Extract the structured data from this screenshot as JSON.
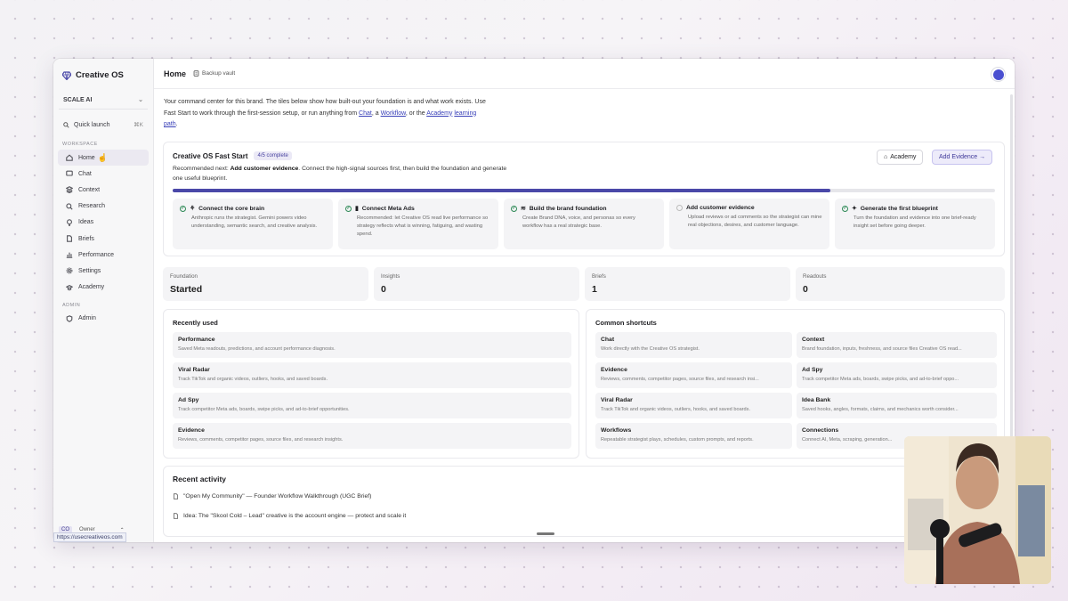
{
  "app": {
    "name": "Creative OS",
    "org": "SCALE AI",
    "quick_launch": "Quick launch",
    "quick_launch_kbd": "⌘K"
  },
  "sidebar": {
    "workspace_label": "WORKSPACE",
    "admin_label": "ADMIN",
    "items": [
      {
        "label": "Home",
        "icon": "home-icon"
      },
      {
        "label": "Chat",
        "icon": "chat-icon"
      },
      {
        "label": "Context",
        "icon": "context-icon"
      },
      {
        "label": "Research",
        "icon": "search-icon"
      },
      {
        "label": "Ideas",
        "icon": "lightbulb-icon"
      },
      {
        "label": "Briefs",
        "icon": "document-icon"
      },
      {
        "label": "Performance",
        "icon": "chart-icon"
      },
      {
        "label": "Settings",
        "icon": "gear-icon"
      },
      {
        "label": "Academy",
        "icon": "graduation-cap-icon"
      }
    ],
    "admin_item": "Admin",
    "footer_co": "CO",
    "footer_role": "Owner"
  },
  "status_url": "https://usecreativeos.com",
  "header": {
    "title": "Home",
    "vault": "Backup vault"
  },
  "intro": {
    "line1": "Your command center for this brand. The tiles below show how built-out your foundation is and what work exists.",
    "line2a": "Use Fast Start to work through the first-session setup, or run anything from ",
    "chat": "Chat",
    "sep1": ", a ",
    "workflow": "Workflow",
    "sep2": ", or the ",
    "academy": "Academy",
    "line2b": "learning path",
    "end": "."
  },
  "fast_start": {
    "title": "Creative OS Fast Start",
    "badge": "4/5 complete",
    "progress": 0.8,
    "rec_prefix": "Recommended next: ",
    "rec_bold": "Add customer evidence",
    "rec_text": ". Connect the high-signal sources first, then build the foundation and generate one useful blueprint.",
    "academy_btn": "Academy",
    "evidence_btn": "Add Evidence →",
    "steps": [
      {
        "title": "Connect the core brain",
        "desc": "Anthropic runs the strategist. Gemini powers video understanding, semantic search, and creative analysis.",
        "done": true
      },
      {
        "title": "Connect Meta Ads",
        "desc": "Recommended: let Creative OS read live performance so strategy reflects what is winning, fatiguing, and wasting spend.",
        "done": true
      },
      {
        "title": "Build the brand foundation",
        "desc": "Create Brand DNA, voice, and personas so every workflow has a real strategic base.",
        "done": true
      },
      {
        "title": "Add customer evidence",
        "desc": "Upload reviews or ad comments so the strategist can mine real objections, desires, and customer language.",
        "done": false
      },
      {
        "title": "Generate the first blueprint",
        "desc": "Turn the foundation and evidence into one brief-ready insight set before going deeper.",
        "done": true
      }
    ]
  },
  "stats": [
    {
      "label": "Foundation",
      "value": "Started"
    },
    {
      "label": "Insights",
      "value": "0"
    },
    {
      "label": "Briefs",
      "value": "1"
    },
    {
      "label": "Readouts",
      "value": "0"
    }
  ],
  "recently_used": {
    "title": "Recently used",
    "items": [
      {
        "title": "Performance",
        "desc": "Saved Meta readouts, predictions, and account performance diagnosis."
      },
      {
        "title": "Viral Radar",
        "desc": "Track TikTok and organic videos, outliers, hooks, and saved boards."
      },
      {
        "title": "Ad Spy",
        "desc": "Track competitor Meta ads, boards, swipe picks, and ad-to-brief opportunities."
      },
      {
        "title": "Evidence",
        "desc": "Reviews, comments, competitor pages, source files, and research insights."
      }
    ]
  },
  "shortcuts": {
    "title": "Common shortcuts",
    "items": [
      {
        "title": "Chat",
        "desc": "Work directly with the Creative OS strategist."
      },
      {
        "title": "Context",
        "desc": "Brand foundation, inputs, freshness, and source files Creative OS read..."
      },
      {
        "title": "Evidence",
        "desc": "Reviews, comments, competitor pages, source files, and research insi..."
      },
      {
        "title": "Ad Spy",
        "desc": "Track competitor Meta ads, boards, swipe picks, and ad-to-brief oppo..."
      },
      {
        "title": "Viral Radar",
        "desc": "Track TikTok and organic videos, outliers, hooks, and saved boards."
      },
      {
        "title": "Idea Bank",
        "desc": "Saved hooks, angles, formats, claims, and mechanics worth consider..."
      },
      {
        "title": "Workflows",
        "desc": "Repeatable strategist plays, schedules, custom prompts, and reports."
      },
      {
        "title": "Connections",
        "desc": "Connect AI, Meta, scraping, generation..."
      }
    ]
  },
  "recent_activity": {
    "title": "Recent activity",
    "items": [
      "\"Open My Community\" — Founder Workflow Walkthrough (UGC Brief)",
      "Idea: The \"Skool Cold – Lead\" creative is the account engine — protect and scale it"
    ]
  }
}
